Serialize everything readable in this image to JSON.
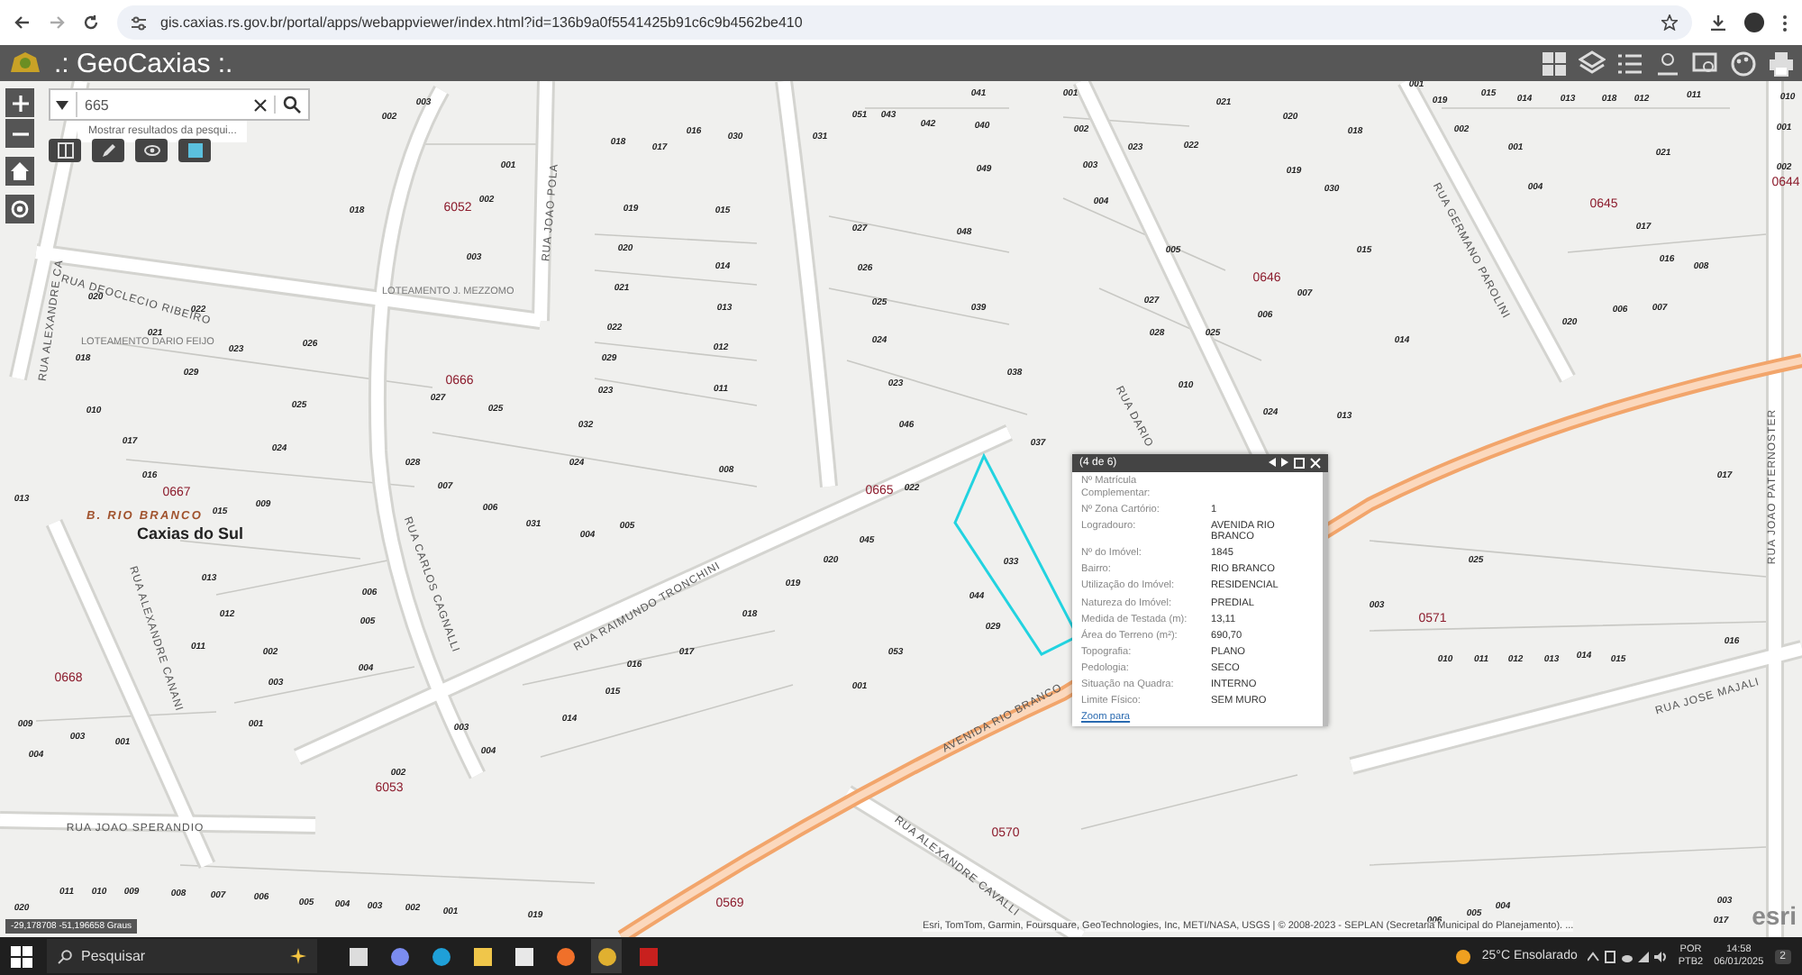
{
  "browser": {
    "url": "gis.caxias.rs.gov.br/portal/apps/webappviewer/index.html?id=136b9a0f5541425b91c6c9b4562be410"
  },
  "app": {
    "title": ".: GeoCaxias :."
  },
  "search": {
    "value": "665",
    "suggestion": "Mostrar resultados da pesqui..."
  },
  "map": {
    "streets": [
      "RUA DEOCLECIO RIBEIRO",
      "RUA ALEXANDRE CA",
      "RUA JOAO POLA",
      "RUA RAIMUNDO TRONCHINI",
      "RUA CARLOS CAGNALLI",
      "RUA ALEXANDRE CANANI",
      "RUA JOAO SPERANDIO",
      "AVENIDA RIO BRANCO",
      "RUA DARIO",
      "RUA GERMANO PAROLINI",
      "RUA JOSE MAJALI",
      "RUA JOAO PATERNOSTER",
      "RUA ALEXANDRE CAVALLI"
    ],
    "places": [
      "LOTEAMENTO J. MEZZOMO",
      "LOTEAMENTO DARIO FEIJO",
      "B. RIO BRANCO",
      "Caxias do Sul"
    ],
    "blocks": [
      "6052",
      "0666",
      "0667",
      "0665",
      "0668",
      "6053",
      "0570",
      "0569",
      "0646",
      "0645",
      "0644",
      "0571"
    ],
    "lots": [
      "002",
      "003",
      "001",
      "018",
      "017",
      "016",
      "030",
      "031",
      "051",
      "043",
      "041",
      "042",
      "040",
      "049",
      "001",
      "002",
      "003",
      "023",
      "022",
      "021",
      "020",
      "018",
      "019",
      "001",
      "019",
      "015",
      "014",
      "013",
      "018",
      "012",
      "011",
      "002",
      "001",
      "021",
      "010",
      "001",
      "002",
      "018",
      "002",
      "003",
      "019",
      "015",
      "020",
      "014",
      "021",
      "013",
      "022",
      "012",
      "029",
      "023",
      "011",
      "020",
      "021",
      "022",
      "023",
      "018",
      "029",
      "026",
      "025",
      "027",
      "025",
      "032",
      "024",
      "008",
      "010",
      "017",
      "016",
      "013",
      "015",
      "024",
      "009",
      "028",
      "007",
      "006",
      "031",
      "004",
      "005",
      "027",
      "048",
      "026",
      "039",
      "025",
      "024",
      "038",
      "023",
      "046",
      "037",
      "022",
      "045",
      "044",
      "020",
      "033",
      "019",
      "018",
      "053",
      "029",
      "001",
      "017",
      "004",
      "005",
      "027",
      "028",
      "025",
      "010",
      "024",
      "013",
      "014",
      "006",
      "007",
      "015",
      "030",
      "004",
      "017",
      "016",
      "008",
      "020",
      "006",
      "007",
      "025",
      "003",
      "017",
      "016",
      "010",
      "011",
      "012",
      "013",
      "014",
      "015",
      "001",
      "002",
      "003",
      "006",
      "005",
      "004",
      "011",
      "012",
      "013",
      "009",
      "003",
      "004",
      "001",
      "002",
      "004",
      "003",
      "014",
      "015",
      "016",
      "020",
      "011",
      "010",
      "009",
      "008",
      "007",
      "006",
      "005",
      "004",
      "003",
      "002",
      "001",
      "019",
      "003",
      "017",
      "004",
      "005",
      "006"
    ]
  },
  "popup": {
    "title": "(4 de 6)",
    "fields": [
      {
        "label": "Nº Matrícula Complementar:"
      },
      {
        "label": "Nº Zona Cartório:",
        "value": "1"
      },
      {
        "label": "Logradouro:",
        "value": "AVENIDA RIO BRANCO"
      },
      {
        "label": "Nº do Imóvel:",
        "value": "1845"
      },
      {
        "label": "Bairro:",
        "value": "RIO BRANCO"
      },
      {
        "label": "Utilização do Imóvel:",
        "value": "RESIDENCIAL"
      },
      {
        "label": "Natureza do Imóvel:",
        "value": "PREDIAL"
      },
      {
        "label": "Medida de Testada (m):",
        "value": "13,11"
      },
      {
        "label": "Área do Terreno (m²):",
        "value": "690,70"
      },
      {
        "label": "Topografia:",
        "value": "PLANO"
      },
      {
        "label": "Pedologia:",
        "value": "SECO"
      },
      {
        "label": "Situação na Quadra:",
        "value": "INTERNO"
      },
      {
        "label": "Limite Físico:",
        "value": "SEM MURO"
      }
    ],
    "link": "Zoom para"
  },
  "coordinates": "-29,178708 -51,196658 Graus",
  "attribution": "Esri, TomTom, Garmin, Foursquare, GeoTechnologies, Inc, METI/NASA, USGS | © 2008-2023 - SEPLAN (Secretaria Municipal do Planejamento). ...",
  "logo": "esri",
  "taskbar": {
    "search_placeholder": "Pesquisar",
    "weather": "25°C Ensolarado",
    "language": "POR",
    "layout": "PTB2",
    "time": "14:58",
    "date": "06/01/2025",
    "notifications": "2"
  }
}
